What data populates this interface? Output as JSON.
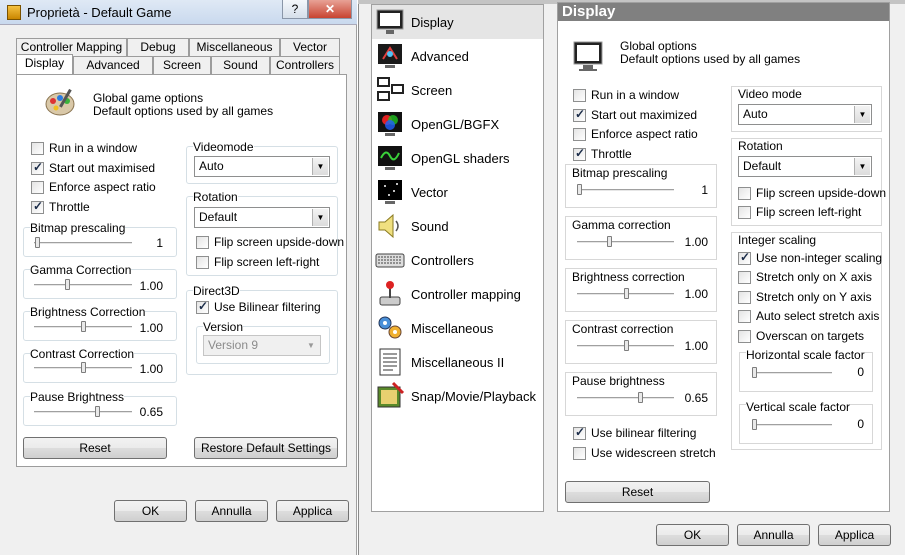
{
  "win1": {
    "title": "Proprietà - Default Game",
    "help_btn": "?",
    "close_btn": "✕",
    "tabs_row1": [
      "Controller Mapping",
      "Debug",
      "Miscellaneous",
      "Vector"
    ],
    "tabs_row2": [
      "Display",
      "Advanced",
      "Screen",
      "Sound",
      "Controllers"
    ],
    "header_line1": "Global game options",
    "header_line2": "Default options used by all games",
    "checkboxes": [
      {
        "label": "Run in a window",
        "checked": false
      },
      {
        "label": "Start out maximised",
        "checked": true
      },
      {
        "label": "Enforce aspect ratio",
        "checked": false
      },
      {
        "label": "Throttle",
        "checked": true
      }
    ],
    "sliders": [
      {
        "label": "Bitmap prescaling",
        "value": "1",
        "pos": 0.0
      },
      {
        "label": "Gamma Correction",
        "value": "1.00",
        "pos": 0.3
      },
      {
        "label": "Brightness Correction",
        "value": "1.00",
        "pos": 0.5
      },
      {
        "label": "Contrast Correction",
        "value": "1.00",
        "pos": 0.5
      },
      {
        "label": "Pause Brightness",
        "value": "0.65",
        "pos": 0.65
      }
    ],
    "videomode_label": "Videomode",
    "videomode_value": "Auto",
    "rotation_label": "Rotation",
    "rotation_value": "Default",
    "flip_ud": "Flip screen upside-down",
    "flip_lr": "Flip screen left-right",
    "direct3d_label": "Direct3D",
    "bilinear": "Use Bilinear filtering",
    "version_label": "Version",
    "version_value": "Version 9",
    "reset": "Reset",
    "restore": "Restore Default Settings",
    "ok": "OK",
    "annulla": "Annulla",
    "applica": "Applica"
  },
  "win2": {
    "nav": [
      "Display",
      "Advanced",
      "Screen",
      "OpenGL/BGFX",
      "OpenGL shaders",
      "Vector",
      "Sound",
      "Controllers",
      "Controller mapping",
      "Miscellaneous",
      "Miscellaneous II",
      "Snap/Movie/Playback"
    ],
    "nav_icons": [
      "monitor-icon",
      "advanced-icon",
      "screens-icon",
      "opengl-icon",
      "shaders-icon",
      "vector-icon",
      "speaker-icon",
      "keyboard-icon",
      "joystick-icon",
      "gears-icon",
      "document-icon",
      "snap-icon"
    ],
    "heading": "Display",
    "header_line1": "Global options",
    "header_line2": "Default options used by all games",
    "checkboxes": [
      {
        "label": "Run in a window",
        "checked": false
      },
      {
        "label": "Start out maximized",
        "checked": true
      },
      {
        "label": "Enforce aspect ratio",
        "checked": false
      },
      {
        "label": "Throttle",
        "checked": true
      }
    ],
    "sliders": [
      {
        "label": "Bitmap prescaling",
        "value": "1",
        "pos": 0.0
      },
      {
        "label": "Gamma correction",
        "value": "1.00",
        "pos": 0.3
      },
      {
        "label": "Brightness correction",
        "value": "1.00",
        "pos": 0.5
      },
      {
        "label": "Contrast correction",
        "value": "1.00",
        "pos": 0.5
      },
      {
        "label": "Pause brightness",
        "value": "0.65",
        "pos": 0.65
      }
    ],
    "bilinear": "Use bilinear filtering",
    "bilinear_checked": true,
    "widescreen": "Use widescreen stretch",
    "widescreen_checked": false,
    "reset": "Reset",
    "videomode_label": "Video mode",
    "videomode_value": "Auto",
    "rotation_label": "Rotation",
    "rotation_value": "Default",
    "flip_ud": "Flip screen upside-down",
    "flip_lr": "Flip screen left-right",
    "integer_label": "Integer scaling",
    "integer_checks": [
      {
        "label": "Use non-integer scaling",
        "checked": true
      },
      {
        "label": "Stretch only on X axis",
        "checked": false
      },
      {
        "label": "Stretch only on Y axis",
        "checked": false
      },
      {
        "label": "Auto select stretch axis",
        "checked": false
      },
      {
        "label": "Overscan on targets",
        "checked": false
      }
    ],
    "hscale_label": "Horizontal scale factor",
    "hscale_value": "0",
    "vscale_label": "Vertical scale factor",
    "vscale_value": "0",
    "ok": "OK",
    "annulla": "Annulla",
    "applica": "Applica"
  }
}
